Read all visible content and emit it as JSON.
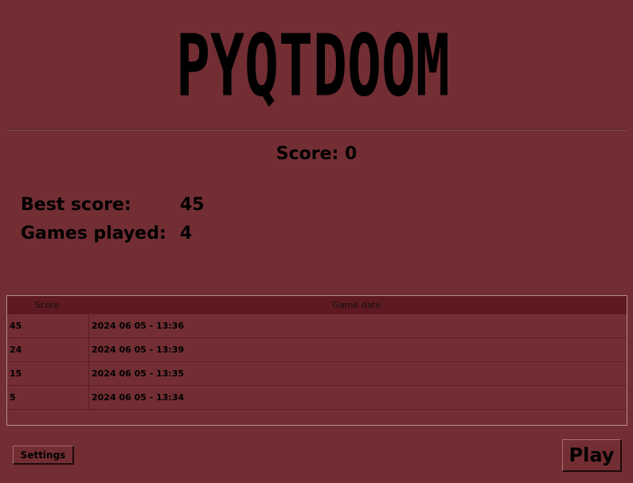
{
  "logo": {
    "text": "PYQTDOOM"
  },
  "score": {
    "label": "Score: 0"
  },
  "stats": {
    "best_label": "Best score:",
    "best_value": "45",
    "games_label": "Games played:",
    "games_value": "4"
  },
  "table": {
    "headers": [
      "Score",
      "Game date"
    ],
    "rows": [
      {
        "score": "45",
        "date": "2024 06 05 - 13:36"
      },
      {
        "score": "24",
        "date": "2024 06 05 - 13:39"
      },
      {
        "score": "15",
        "date": "2024 06 05 - 13:35"
      },
      {
        "score": "5",
        "date": "2024 06 05 - 13:34"
      }
    ]
  },
  "buttons": {
    "settings": "Settings",
    "play": "Play"
  },
  "colors": {
    "background": "#722e33",
    "header_bg": "#5e1a20",
    "text": "#000000"
  }
}
